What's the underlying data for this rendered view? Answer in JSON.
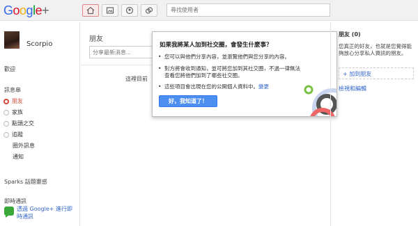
{
  "app": {
    "logo_text": "Google+"
  },
  "nav": {
    "buttons": [
      {
        "name": "home-icon",
        "active": true
      },
      {
        "name": "photos-icon",
        "active": false
      },
      {
        "name": "profile-icon",
        "active": false
      },
      {
        "name": "circles-icon",
        "active": false
      }
    ]
  },
  "search": {
    "placeholder": "尋找使用者"
  },
  "sidebar": {
    "username": "Scorpio",
    "welcome": "歡迎",
    "stream_heading": "訊息串",
    "circles": [
      {
        "label": "朋友",
        "active": true
      },
      {
        "label": "家族",
        "active": false
      },
      {
        "label": "點頭之交",
        "active": false
      },
      {
        "label": "追蹤",
        "active": false
      }
    ],
    "extras": [
      {
        "label": "圈外訊息"
      },
      {
        "label": "通知"
      }
    ],
    "sparks": "Sparks 話題靈感",
    "chat_heading": "即時通訊",
    "chat_link": "透過 Google+ 進行即時通訊"
  },
  "main": {
    "title": "朋友",
    "share_placeholder": "分享最新消息...",
    "empty_text": "這裡目前"
  },
  "popup": {
    "title": "如果我將某人加到社交圈，會發生什麼事？",
    "bullets": [
      {
        "text": "您可以與他們分享內容，並瀏覽他們與您分享的內容。",
        "link": ""
      },
      {
        "text": "對方將會收到通知，並可將您加到其社交圈，不過一律無法查看您將他們加到了哪些社交圈。",
        "link": ""
      },
      {
        "text": "這些項目會出現在您的公開個人資料中。",
        "link": "變更"
      }
    ],
    "ok_button": "好，我知道了！"
  },
  "right": {
    "title": "朋友 (0)",
    "description": "您真正的好友，也就是您覺得能夠放心分享私人資訊的朋友。",
    "add_label": "+ 加到朋友",
    "edit_label": "檢視和編輯"
  },
  "colors": {
    "accent_red": "#d14836",
    "link_blue": "#3366cc",
    "button_blue": "#4d8ff0"
  }
}
